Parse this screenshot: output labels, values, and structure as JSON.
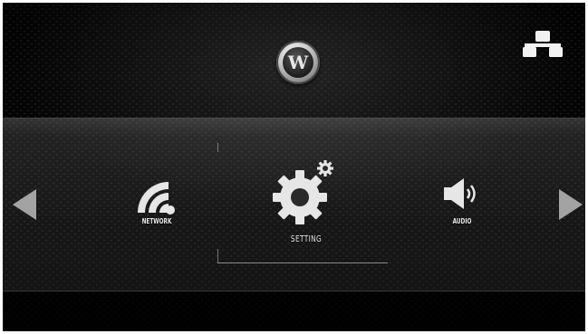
{
  "header": {
    "logo_letter": "W",
    "logo_icon": "westinghouse-logo-icon",
    "status_icon": "network-connected-icon"
  },
  "navigation": {
    "left_icon": "arrow-left-icon",
    "right_icon": "arrow-right-icon"
  },
  "menu": {
    "items": [
      {
        "label": "NETWORK",
        "icon": "wifi-icon"
      },
      {
        "label": "SETTING",
        "icon": "gear-icon",
        "selected": true
      },
      {
        "label": "AUDIO",
        "icon": "speaker-icon"
      }
    ]
  },
  "colors": {
    "icon": "#e6e6e6",
    "arrow": "#a0a0a0",
    "background": "#1d1d1d"
  }
}
